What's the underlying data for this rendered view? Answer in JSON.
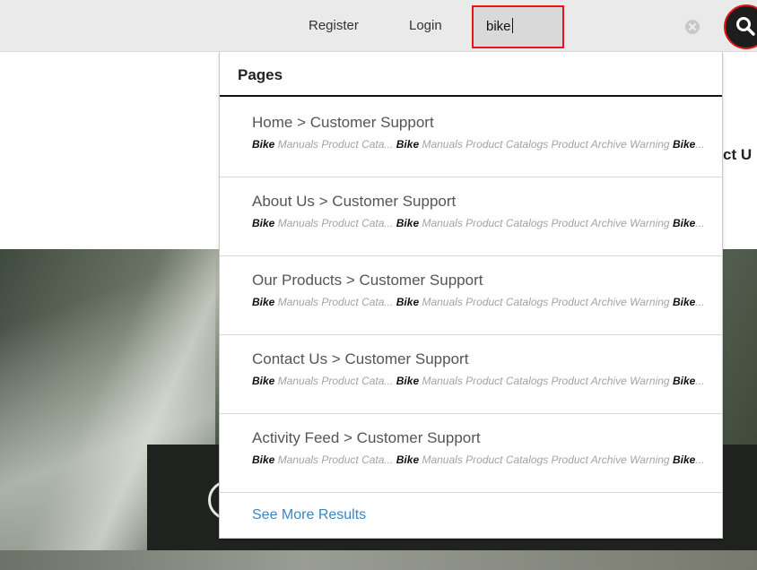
{
  "header": {
    "register_label": "Register",
    "login_label": "Login",
    "search": {
      "value": "bike"
    }
  },
  "background": {
    "partial_text": "ct U"
  },
  "dropdown": {
    "section_title": "Pages",
    "results": [
      {
        "title": "Home > Customer Support",
        "snippet": {
          "t1": "Bike",
          "t2": " Manuals Product Cata... ",
          "t3": "Bike",
          "t4": " Manuals Product Catalogs Product Archive Warning ",
          "t5": "Bike",
          "t6": "..."
        }
      },
      {
        "title": "About Us > Customer Support",
        "snippet": {
          "t1": "Bike",
          "t2": " Manuals Product Cata... ",
          "t3": "Bike",
          "t4": " Manuals Product Catalogs Product Archive Warning ",
          "t5": "Bike",
          "t6": "..."
        }
      },
      {
        "title": "Our Products > Customer Support",
        "snippet": {
          "t1": "Bike",
          "t2": " Manuals Product Cata... ",
          "t3": "Bike",
          "t4": " Manuals Product Catalogs Product Archive Warning ",
          "t5": "Bike",
          "t6": "..."
        }
      },
      {
        "title": "Contact Us > Customer Support",
        "snippet": {
          "t1": "Bike",
          "t2": " Manuals Product Cata... ",
          "t3": "Bike",
          "t4": " Manuals Product Catalogs Product Archive Warning ",
          "t5": "Bike",
          "t6": "..."
        }
      },
      {
        "title": "Activity Feed > Customer Support",
        "snippet": {
          "t1": "Bike",
          "t2": " Manuals Product Cata... ",
          "t3": "Bike",
          "t4": " Manuals Product Catalogs Product Archive Warning ",
          "t5": "Bike",
          "t6": "..."
        }
      }
    ],
    "see_more_label": "See More Results"
  },
  "icons": {
    "clear": "clear-circle-icon",
    "search": "magnifier-icon"
  },
  "colors": {
    "highlight_border": "#e2171b",
    "link": "#3a85c6",
    "topbar": "#eaeaea"
  }
}
